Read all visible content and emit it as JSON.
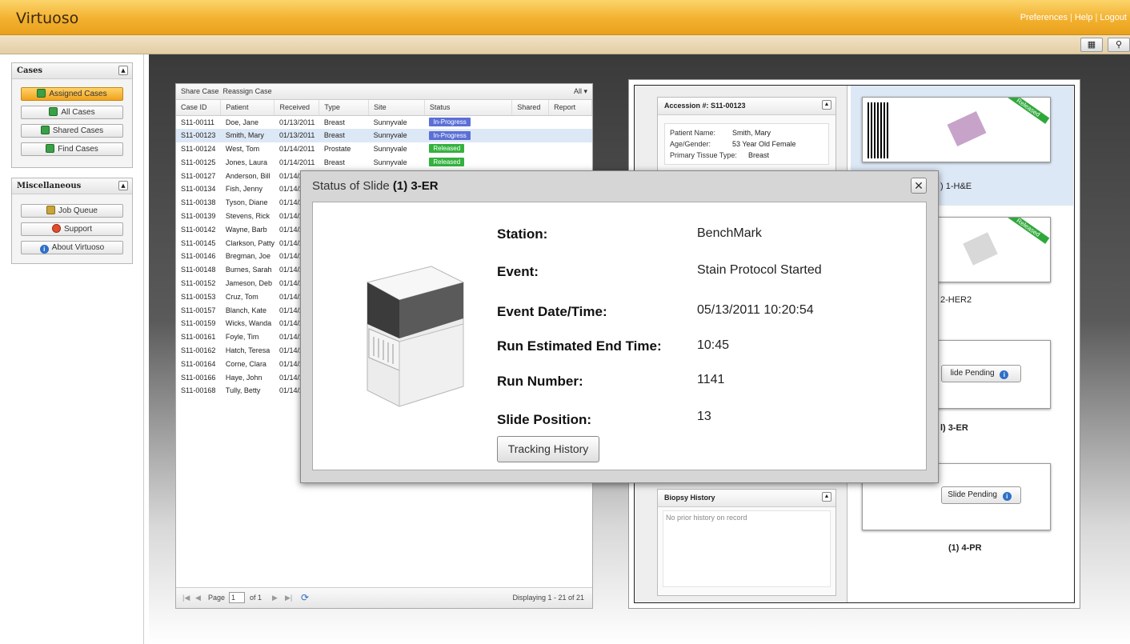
{
  "app": {
    "title": "Virtuoso"
  },
  "header": {
    "links": [
      "Preferences",
      "Help",
      "Logout"
    ]
  },
  "sidebar": {
    "cases_title": "Cases",
    "cases_items": [
      {
        "label": "Assigned Cases",
        "active": true
      },
      {
        "label": "All Cases"
      },
      {
        "label": "Shared Cases"
      },
      {
        "label": "Find Cases"
      }
    ],
    "misc_title": "Miscellaneous",
    "misc_items": [
      {
        "label": "Job Queue",
        "icon": "job-queue-icon"
      },
      {
        "label": "Support",
        "icon": "support-icon"
      },
      {
        "label": "About Virtuoso",
        "icon": "info-icon"
      }
    ]
  },
  "caselist": {
    "toolbar": {
      "share": "Share Case",
      "reassign": "Reassign Case",
      "filter": "All ▾"
    },
    "columns": [
      "Case ID",
      "Patient",
      "Received",
      "Type",
      "Site",
      "Status",
      "Shared",
      "Report"
    ],
    "rows": [
      {
        "id": "S11-00111",
        "patient": "Doe, Jane",
        "received": "01/13/2011",
        "type": "Breast",
        "site": "Sunnyvale",
        "status": "In-Progress"
      },
      {
        "id": "S11-00123",
        "patient": "Smith, Mary",
        "received": "01/13/2011",
        "type": "Breast",
        "site": "Sunnyvale",
        "status": "In-Progress",
        "selected": true
      },
      {
        "id": "S11-00124",
        "patient": "West, Tom",
        "received": "01/14/2011",
        "type": "Prostate",
        "site": "Sunnyvale",
        "status": "Released"
      },
      {
        "id": "S11-00125",
        "patient": "Jones, Laura",
        "received": "01/14/2011",
        "type": "Breast",
        "site": "Sunnyvale",
        "status": "Released"
      },
      {
        "id": "S11-00127",
        "patient": "Anderson, Bill",
        "received": "01/14/2"
      },
      {
        "id": "S11-00134",
        "patient": "Fish, Jenny",
        "received": "01/14/2"
      },
      {
        "id": "S11-00138",
        "patient": "Tyson, Diane",
        "received": "01/14/2"
      },
      {
        "id": "S11-00139",
        "patient": "Stevens, Rick",
        "received": "01/14/2"
      },
      {
        "id": "S11-00142",
        "patient": "Wayne, Barb",
        "received": "01/14/2"
      },
      {
        "id": "S11-00145",
        "patient": "Clarkson, Patty",
        "received": "01/14/2"
      },
      {
        "id": "S11-00146",
        "patient": "Bregman, Joe",
        "received": "01/14/2"
      },
      {
        "id": "S11-00148",
        "patient": "Burnes, Sarah",
        "received": "01/14/2"
      },
      {
        "id": "S11-00152",
        "patient": "Jameson, Deb",
        "received": "01/14/2"
      },
      {
        "id": "S11-00153",
        "patient": "Cruz, Tom",
        "received": "01/14/2"
      },
      {
        "id": "S11-00157",
        "patient": "Blanch, Kate",
        "received": "01/14/2"
      },
      {
        "id": "S11-00159",
        "patient": "Wicks, Wanda",
        "received": "01/14/2"
      },
      {
        "id": "S11-00161",
        "patient": "Foyle, Tim",
        "received": "01/14/2"
      },
      {
        "id": "S11-00162",
        "patient": "Hatch, Teresa",
        "received": "01/14/2"
      },
      {
        "id": "S11-00164",
        "patient": "Corne, Clara",
        "received": "01/14/2"
      },
      {
        "id": "S11-00166",
        "patient": "Haye, John",
        "received": "01/14/2"
      },
      {
        "id": "S11-00168",
        "patient": "Tully, Betty",
        "received": "01/14/2"
      }
    ],
    "footer": {
      "page_label": "Page",
      "page_value": "1",
      "of_label": "of 1",
      "displaying": "Displaying 1 - 21 of 21"
    }
  },
  "detail": {
    "accession_title": "Accession #:  S11-00123",
    "patient_fields": [
      {
        "k": "Patient Name:",
        "v": "Smith, Mary"
      },
      {
        "k": "Age/Gender:",
        "v": "53 Year Old Female"
      },
      {
        "k": "Primary Tissue Type:",
        "v": "Breast"
      }
    ],
    "biopsy_title": "Biopsy History",
    "biopsy_empty": "No prior history on record",
    "slides": [
      {
        "label": ") 1-H&E",
        "tag": "Released"
      },
      {
        "label": "2-HER2",
        "tag": "Released"
      },
      {
        "label": "l) 3-ER",
        "pending": "lide Pending"
      },
      {
        "label": "(1) 4-PR",
        "pending": "Slide Pending"
      }
    ]
  },
  "dialog": {
    "title_prefix": "Status of Slide",
    "title_slide": "(1) 3-ER",
    "fields": [
      {
        "label": "Station:",
        "value": "BenchMark"
      },
      {
        "label": "Event:",
        "value": "Stain Protocol Started"
      },
      {
        "label": "Event Date/Time:",
        "value": "05/13/2011 10:20:54"
      },
      {
        "label": "Run Estimated End Time:",
        "value": "10:45"
      },
      {
        "label": "Run Number:",
        "value": "1141"
      },
      {
        "label": "Slide Position:",
        "value": "13"
      }
    ],
    "button": "Tracking History"
  },
  "colors": {
    "accent": "#f3b12f",
    "in_progress": "#5b6fd6",
    "released": "#33b23e"
  }
}
